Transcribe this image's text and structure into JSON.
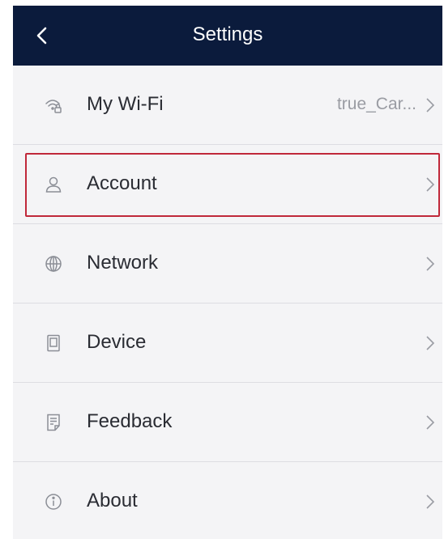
{
  "header": {
    "title": "Settings"
  },
  "settings": [
    {
      "label": "My Wi-Fi",
      "value": "true_Car...",
      "icon": "wifi-lock-icon"
    },
    {
      "label": "Account",
      "value": "",
      "icon": "person-icon"
    },
    {
      "label": "Network",
      "value": "",
      "icon": "globe-icon"
    },
    {
      "label": "Device",
      "value": "",
      "icon": "device-icon"
    },
    {
      "label": "Feedback",
      "value": "",
      "icon": "document-icon"
    },
    {
      "label": "About",
      "value": "",
      "icon": "info-icon"
    }
  ],
  "colors": {
    "header_bg": "#0b1b3c",
    "highlight_border": "#c0283a",
    "list_bg": "#f4f4f6"
  }
}
